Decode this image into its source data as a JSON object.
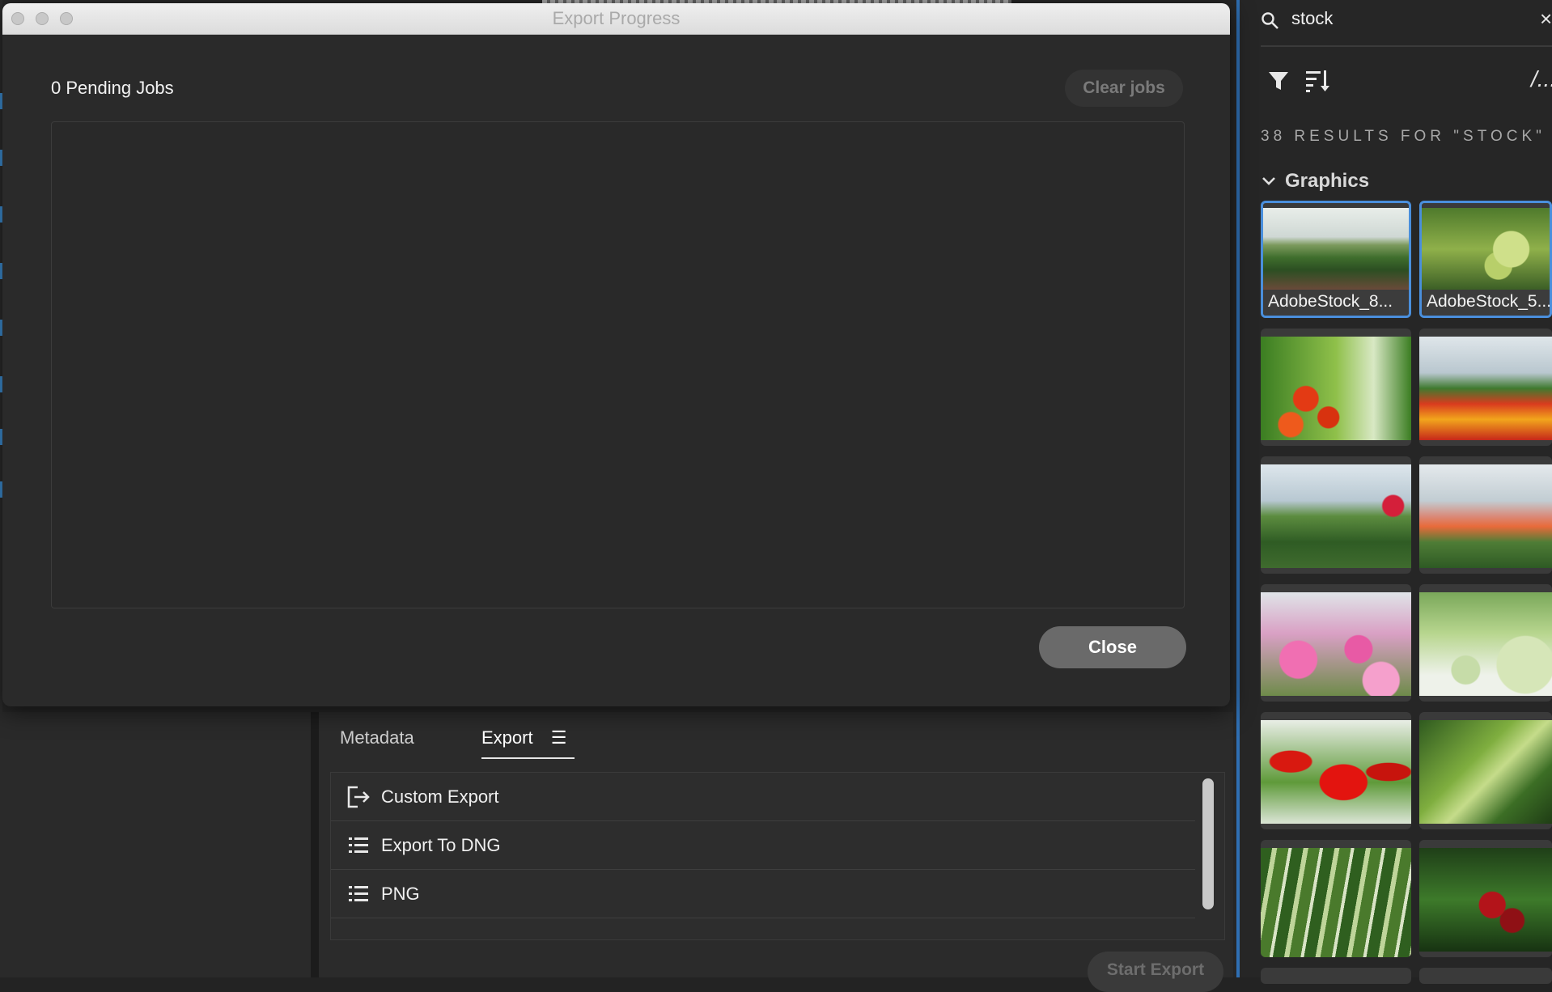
{
  "modal": {
    "window_title": "Export Progress",
    "pending_jobs_label": "0 Pending Jobs",
    "clear_jobs_label": "Clear jobs",
    "close_label": "Close"
  },
  "export_panel": {
    "tabs": [
      {
        "label": "Metadata",
        "active": false
      },
      {
        "label": "Export",
        "active": true,
        "menu_icon": "hamburger-menu-icon"
      }
    ],
    "presets": [
      {
        "label": "Custom Export",
        "icon": "export-arrow-icon"
      },
      {
        "label": "Export To DNG",
        "icon": "list-icon"
      },
      {
        "label": "PNG",
        "icon": "list-icon"
      }
    ],
    "start_export_label": "Start Export"
  },
  "search_panel": {
    "query": "stock",
    "clear_glyph": "×",
    "more_glyph": "/...",
    "results_label": "38 RESULTS FOR \"STOCK\"",
    "section_label": "Graphics",
    "thumbnails": [
      {
        "caption": "AdobeStock_8...",
        "selected": true
      },
      {
        "caption": "AdobeStock_5...",
        "selected": true
      },
      {
        "caption": "",
        "selected": false
      },
      {
        "caption": "",
        "selected": false
      },
      {
        "caption": "",
        "selected": false
      },
      {
        "caption": "",
        "selected": false
      },
      {
        "caption": "",
        "selected": false
      },
      {
        "caption": "",
        "selected": false
      },
      {
        "caption": "",
        "selected": false
      },
      {
        "caption": "",
        "selected": false
      },
      {
        "caption": "",
        "selected": false
      },
      {
        "caption": "",
        "selected": false
      }
    ]
  },
  "colors": {
    "accent": "#3d8fd6",
    "selection_border": "#4a8fdc",
    "panel_bg": "#2a2a2a"
  }
}
